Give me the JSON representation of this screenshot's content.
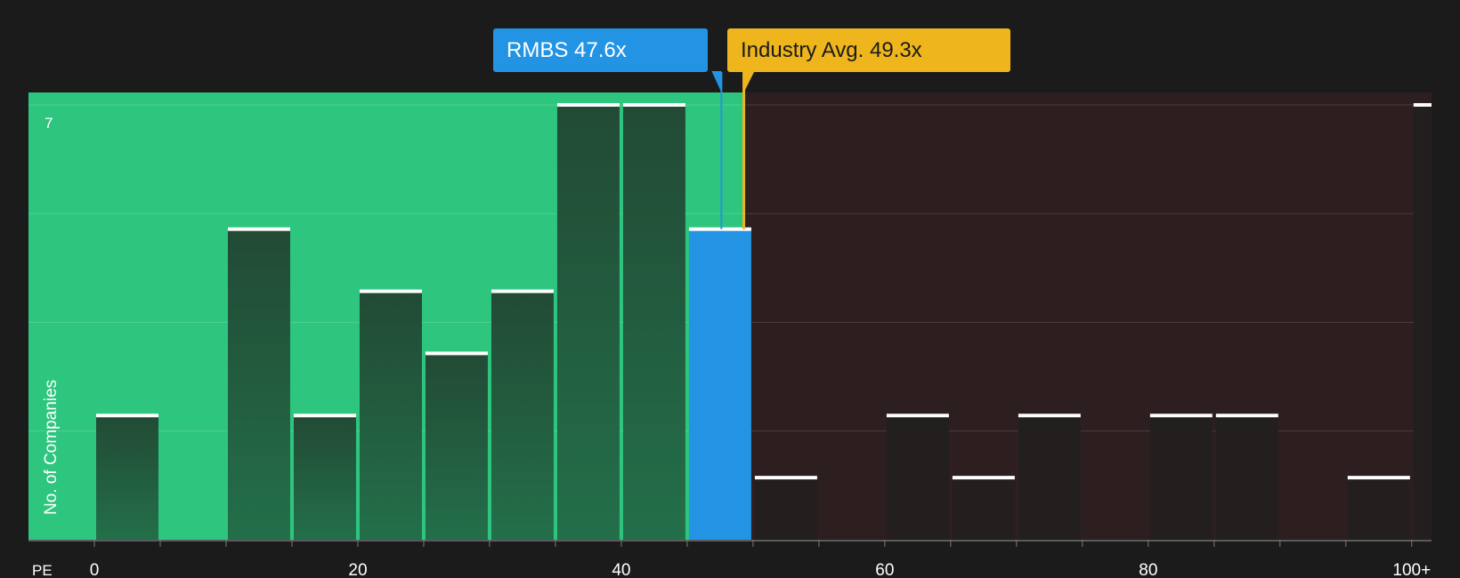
{
  "chart_data": {
    "type": "bar",
    "title": "",
    "xlabel": "PE",
    "ylabel": "No. of Companies",
    "xlim": [
      -5,
      101.5
    ],
    "ylim": [
      0,
      7.2
    ],
    "x_ticks": [
      0,
      20,
      40,
      60,
      80,
      100
    ],
    "x_tick_labels": [
      "0",
      "20",
      "40",
      "60",
      "80",
      "100+"
    ],
    "y_tick_labels": [
      {
        "value": 7,
        "label": "7"
      }
    ],
    "gridlines_at": [
      1.75,
      3.5,
      5.25,
      7
    ],
    "bin_width": 5,
    "bins": [
      {
        "start": 0,
        "count": 2
      },
      {
        "start": 5,
        "count": 0
      },
      {
        "start": 10,
        "count": 5
      },
      {
        "start": 15,
        "count": 2
      },
      {
        "start": 20,
        "count": 4
      },
      {
        "start": 25,
        "count": 3
      },
      {
        "start": 30,
        "count": 4
      },
      {
        "start": 35,
        "count": 7
      },
      {
        "start": 40,
        "count": 7
      },
      {
        "start": 45,
        "count": 5,
        "highlight": true
      },
      {
        "start": 50,
        "count": 1
      },
      {
        "start": 55,
        "count": 0
      },
      {
        "start": 60,
        "count": 2
      },
      {
        "start": 65,
        "count": 1
      },
      {
        "start": 70,
        "count": 2
      },
      {
        "start": 75,
        "count": 0
      },
      {
        "start": 80,
        "count": 2
      },
      {
        "start": 85,
        "count": 2
      },
      {
        "start": 90,
        "count": 0
      },
      {
        "start": 95,
        "count": 1
      },
      {
        "start": 100,
        "count": 7,
        "overflow": true
      }
    ],
    "company": {
      "ticker": "RMBS",
      "value": 47.6,
      "label": "RMBS 47.6x"
    },
    "industry": {
      "value": 49.3,
      "label": "Industry Avg. 49.3x"
    },
    "colors": {
      "background": "#1b1b1c",
      "below_region": "#2ec67f",
      "above_region": "#2d1e1f",
      "bar_dark": "#224a35",
      "bar_light": "#236f4a",
      "bar_above": "#241f1f",
      "highlight": "#2394e3",
      "industry": "#efb51c",
      "cap": "#ffffff",
      "text": "#ffffff"
    }
  }
}
